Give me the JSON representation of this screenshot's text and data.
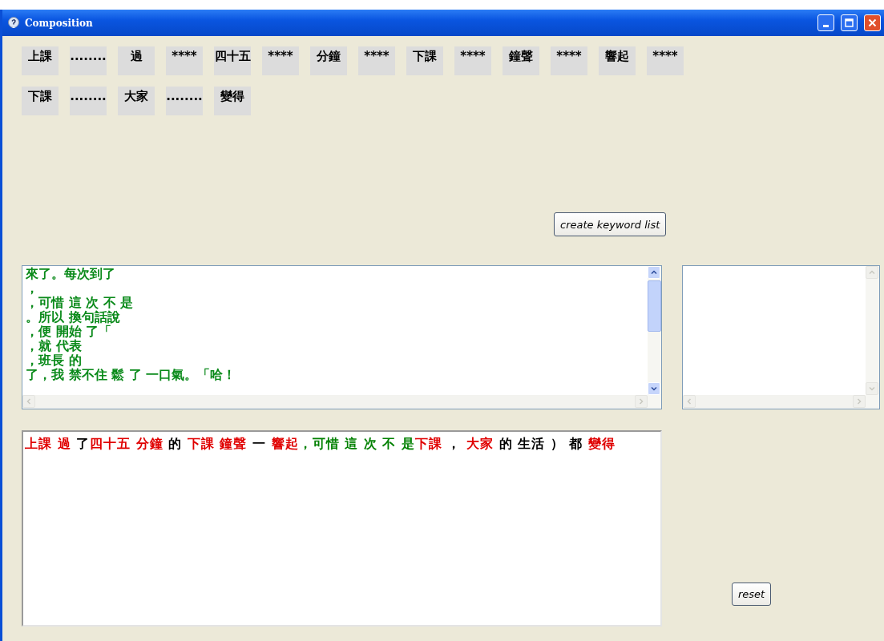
{
  "window": {
    "title": "Composition"
  },
  "tile_rows": [
    [
      "上課",
      "........",
      "過",
      "****",
      "四十五",
      "****",
      "分鐘",
      "****",
      "下課",
      "****",
      "鐘聲",
      "****",
      "響起",
      "****"
    ],
    [
      "下課",
      "........",
      "大家",
      "........",
      "變得"
    ]
  ],
  "create_button": {
    "label": "create keyword list"
  },
  "source_text": {
    "lines": [
      "來了。每次到了",
      "，",
      "，可惜 這 次 不 是",
      "。所以 換句話說",
      "，便 開始 了「",
      "，就 代表",
      "，班長 的",
      "了，我 禁不住 鬆 了 一口氣。「哈！"
    ]
  },
  "composition": {
    "segments": [
      {
        "text": "上課",
        "color": "#e00000"
      },
      {
        "text": " 過",
        "color": "#e00000"
      },
      {
        "text": " 了",
        "color": "#000000"
      },
      {
        "text": "四十五",
        "color": "#e00000"
      },
      {
        "text": " 分鐘",
        "color": "#e00000"
      },
      {
        "text": " 的 ",
        "color": "#000000"
      },
      {
        "text": "下課",
        "color": "#e00000"
      },
      {
        "text": " 鐘聲",
        "color": "#e00000"
      },
      {
        "text": " 一 ",
        "color": "#000000"
      },
      {
        "text": "響起",
        "color": "#e00000"
      },
      {
        "text": "，可惜 這 次 不 是",
        "color": "#008000"
      },
      {
        "text": "下課",
        "color": "#e00000"
      },
      {
        "text": " ， ",
        "color": "#000000"
      },
      {
        "text": "大家",
        "color": "#e00000"
      },
      {
        "text": " 的 生活 ） 都 ",
        "color": "#000000"
      },
      {
        "text": "變得",
        "color": "#e00000"
      }
    ]
  },
  "reset_button": {
    "label": "reset"
  }
}
